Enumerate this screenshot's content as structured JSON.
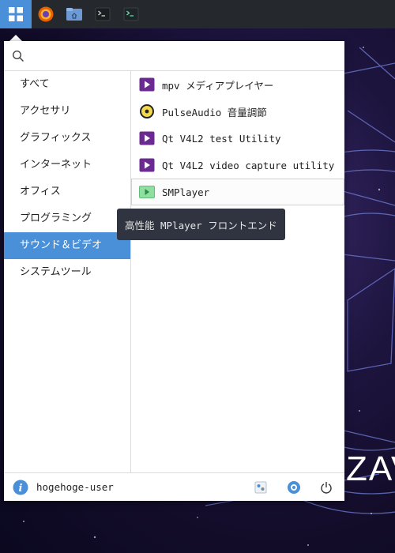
{
  "taskbar": {
    "items": [
      {
        "name": "application-menu",
        "icon": "grid-icon"
      },
      {
        "name": "firefox",
        "icon": "firefox-icon"
      },
      {
        "name": "file-manager",
        "icon": "folder-icon"
      },
      {
        "name": "terminal-1",
        "icon": "terminal-icon"
      },
      {
        "name": "terminal-2",
        "icon": "terminal-icon"
      }
    ]
  },
  "search": {
    "placeholder": "",
    "value": ""
  },
  "categories": [
    {
      "label": "すべて",
      "selected": false
    },
    {
      "label": "アクセサリ",
      "selected": false
    },
    {
      "label": "グラフィックス",
      "selected": false
    },
    {
      "label": "インターネット",
      "selected": false
    },
    {
      "label": "オフィス",
      "selected": false
    },
    {
      "label": "プログラミング",
      "selected": false
    },
    {
      "label": "サウンド＆ビデオ",
      "selected": true
    },
    {
      "label": "システムツール",
      "selected": false
    }
  ],
  "apps": [
    {
      "label": "mpv メディアプレイヤー",
      "icon": "mpv-play-icon"
    },
    {
      "label": "PulseAudio 音量調節",
      "icon": "speaker-icon"
    },
    {
      "label": "Qt V4L2 test Utility",
      "icon": "qt-v4l2-icon"
    },
    {
      "label": "Qt V4L2 video capture utility",
      "icon": "qt-v4l2-icon"
    },
    {
      "label": "SMPlayer",
      "icon": "smplayer-icon"
    }
  ],
  "tooltip": "高性能 MPlayer フロントエンド",
  "footer": {
    "username": "hogehoge-user"
  },
  "colors": {
    "accent": "#4a90d9",
    "taskbar": "#25282d",
    "tooltip_bg": "#2f3440"
  }
}
